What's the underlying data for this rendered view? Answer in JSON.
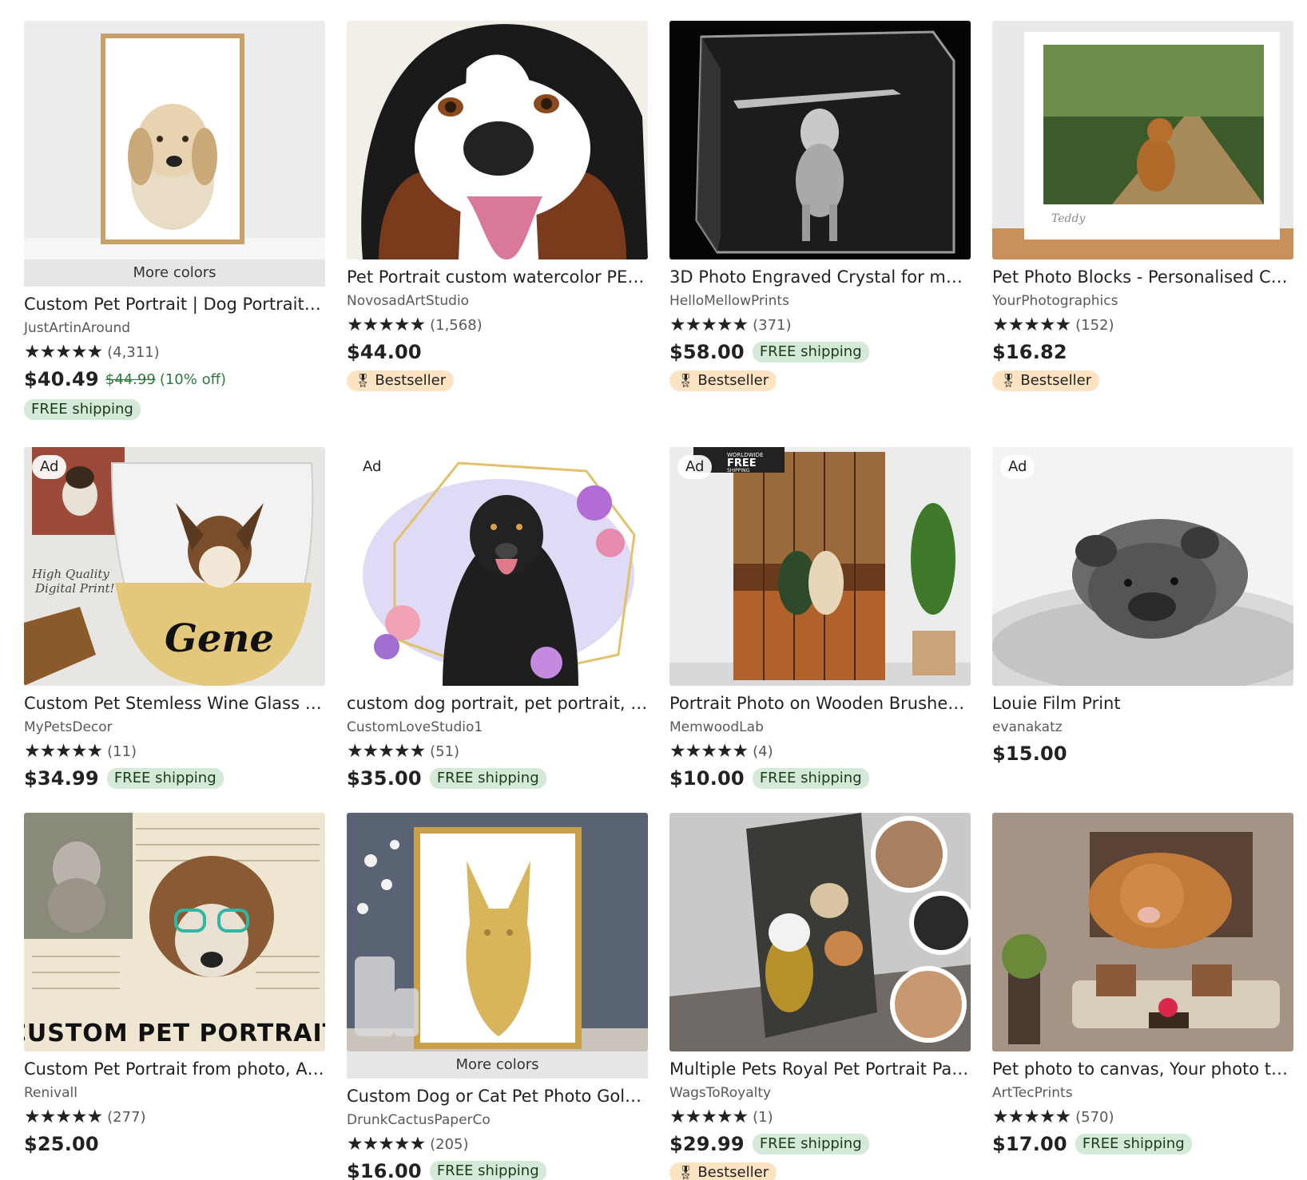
{
  "badges": {
    "ad": "Ad",
    "more_colors": "More colors",
    "free_shipping": "FREE shipping",
    "bestseller": "Bestseller",
    "stars": "★★★★★"
  },
  "listings": [
    {
      "title": "Custom Pet Portrait | Dog Portrait | ...",
      "shop": "JustArtinAround",
      "count": "(4,311)",
      "price": "$40.49",
      "orig_price": "$44.99",
      "discount": "(10% off)"
    },
    {
      "title": "Pet Portrait custom watercolor PET ...",
      "shop": "NovosadArtStudio",
      "count": "(1,568)",
      "price": "$44.00"
    },
    {
      "title": "3D Photo Engraved Crystal for mem...",
      "shop": "HelloMellowPrints",
      "count": "(371)",
      "price": "$58.00"
    },
    {
      "title": "Pet Photo Blocks - Personalised Chu...",
      "shop": "YourPhotographics",
      "count": "(152)",
      "price": "$16.82",
      "image_text": "Teddy"
    },
    {
      "title": "Custom Pet Stemless Wine Glass Se...",
      "shop": "MyPetsDecor",
      "count": "(11)",
      "price": "$34.99",
      "image_text_1": "High Quality",
      "image_text_2": "Digital Print!",
      "image_text_3": "Gene"
    },
    {
      "title": "custom dog portrait, pet portrait, c...",
      "shop": "CustomLoveStudio1",
      "count": "(51)",
      "price": "$35.00"
    },
    {
      "title": "Portrait Photo on Wooden Brushed ...",
      "shop": "MemwoodLab",
      "count": "(4)",
      "price": "$10.00",
      "image_text_1": "WORLDWIDE",
      "image_text_2": "FREE",
      "image_text_3": "SHIPPING"
    },
    {
      "title": "Louie Film Print",
      "shop": "evanakatz",
      "price": "$15.00"
    },
    {
      "title": "Custom Pet Portrait from photo, Art...",
      "shop": "Renivall",
      "count": "(277)",
      "price": "$25.00",
      "image_text": "CUSTOM PET PORTRAIT"
    },
    {
      "title": "Custom Dog or Cat Pet Photo Gold ...",
      "shop": "DrunkCactusPaperCo",
      "count": "(205)",
      "price": "$16.00"
    },
    {
      "title": "Multiple Pets Royal Pet Portrait Pain...",
      "shop": "WagsToRoyalty",
      "count": "(1)",
      "price": "$29.99"
    },
    {
      "title": "Pet photo to canvas, Your photo to ...",
      "shop": "ArtTecPrints",
      "count": "(570)",
      "price": "$17.00"
    }
  ]
}
